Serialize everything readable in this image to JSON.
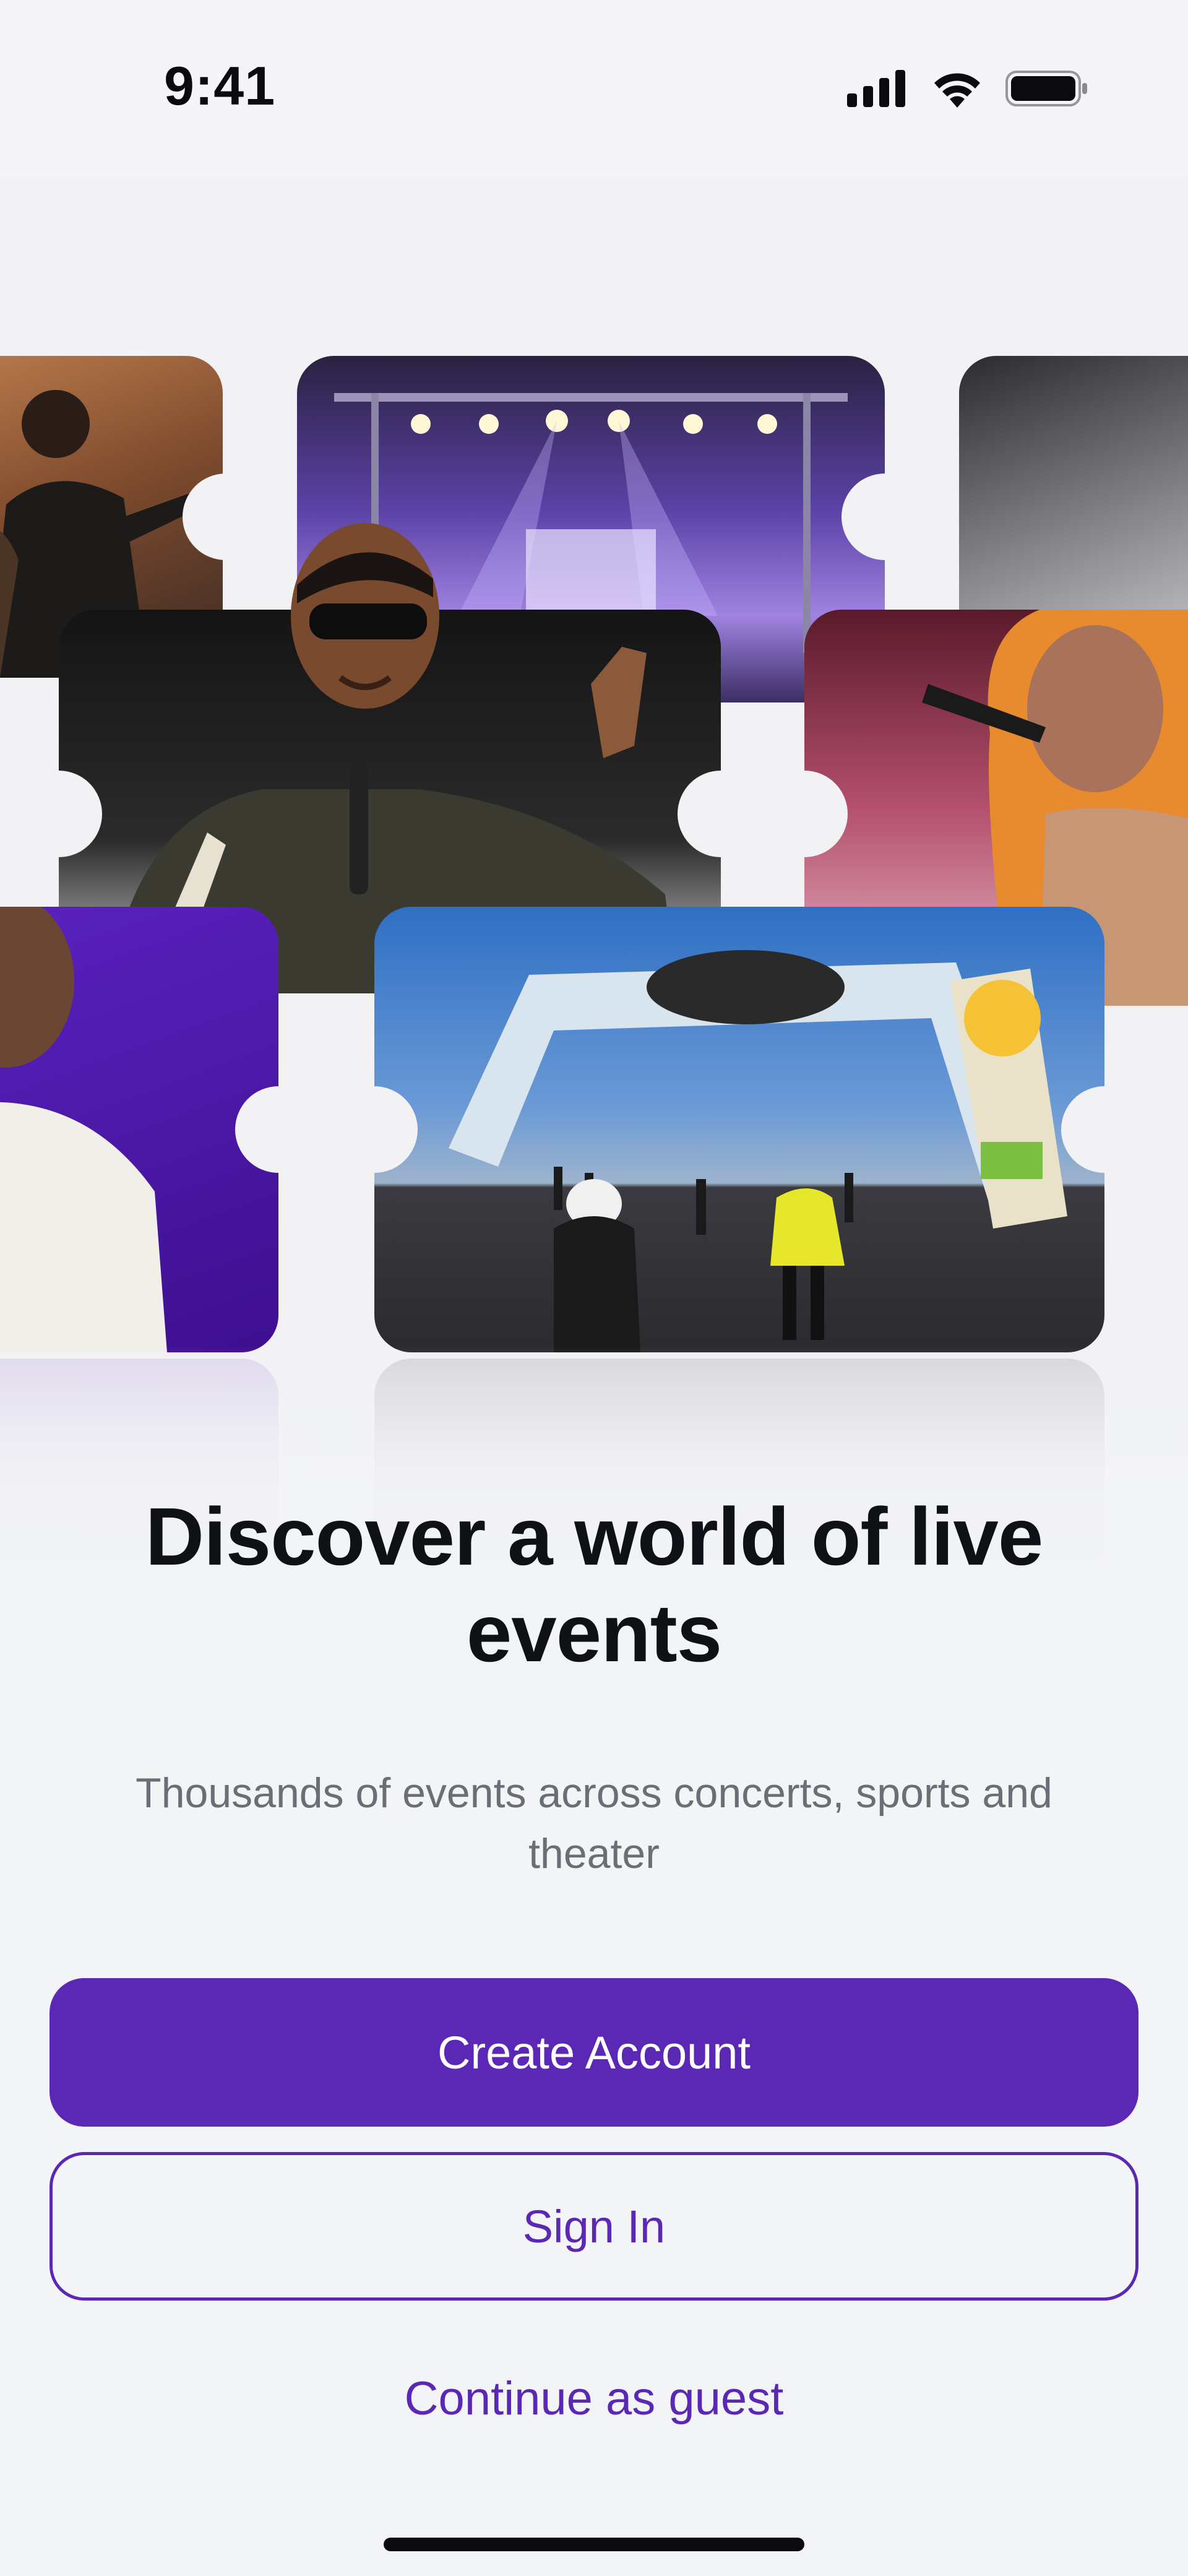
{
  "status_bar": {
    "time": "9:41"
  },
  "hero": {
    "images": [
      {
        "name": "orchestra-conductor",
        "accent": "#8a5a3a"
      },
      {
        "name": "concert-stage-lights",
        "accent": "#6a4fc9"
      },
      {
        "name": "performer-bw",
        "accent": "#3a3a3a"
      },
      {
        "name": "rapper-with-microphone",
        "accent": "#2c2c2c"
      },
      {
        "name": "singer-with-microphone",
        "accent": "#c94a6a"
      },
      {
        "name": "performer-white-suit",
        "accent": "#4a19a8"
      },
      {
        "name": "festival-entrance-arch",
        "accent": "#2f6fc4"
      }
    ]
  },
  "onboarding": {
    "headline": "Discover a world of live events",
    "subtitle": "Thousands of events across concerts, sports and theater"
  },
  "actions": {
    "create_account": "Create Account",
    "sign_in": "Sign In",
    "guest": "Continue as guest"
  },
  "theme": {
    "primary": "#5b27b5",
    "background": "#f3f4f6"
  }
}
